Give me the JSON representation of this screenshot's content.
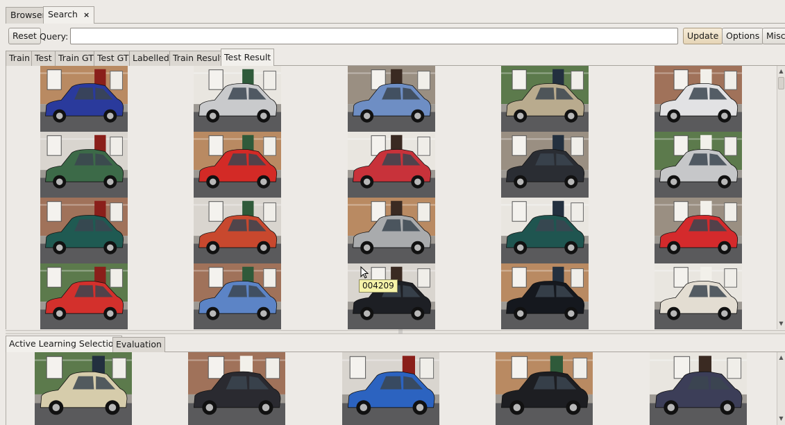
{
  "top_tabs": [
    {
      "label": "Browser",
      "active": false
    },
    {
      "label": "Search",
      "active": true
    }
  ],
  "close_glyph": "×",
  "toolbar": {
    "reset_label": "Reset",
    "query_label": "Query:",
    "query_value": "",
    "update_label": "Update",
    "options_label": "Options",
    "misc_label": "Misc"
  },
  "result_tabs": [
    "Train",
    "Test",
    "Train GT",
    "Test GT",
    "Labelled",
    "Train Result",
    "Test Result"
  ],
  "active_result_tab": "Test Result",
  "grid": {
    "rows": [
      [
        "#2a3a9c",
        "#c9cacc",
        "#6e8ec4",
        "#b9ab8e",
        "#e2e2e4"
      ],
      [
        "#3c6a48",
        "#d32a26",
        "#c8323a",
        "#2a2d33",
        "#c6c7c9"
      ],
      [
        "#1f5a52",
        "#c8482e",
        "#a9abad",
        "#1f5550",
        "#d42a2c"
      ],
      [
        "#d3302c",
        "#5c84c6",
        "#1d1f24",
        "#15181e",
        "#e3ddd2"
      ]
    ],
    "tooltip": "004209"
  },
  "bottom_tabs": [
    {
      "label": "Active Learning Selection",
      "active": true
    },
    {
      "label": "Evaluation",
      "active": false
    }
  ],
  "bottom_cars": [
    "#d6ccab",
    "#2a2a30",
    "#2c63c0",
    "#1d1e22",
    "#3c3e58"
  ]
}
